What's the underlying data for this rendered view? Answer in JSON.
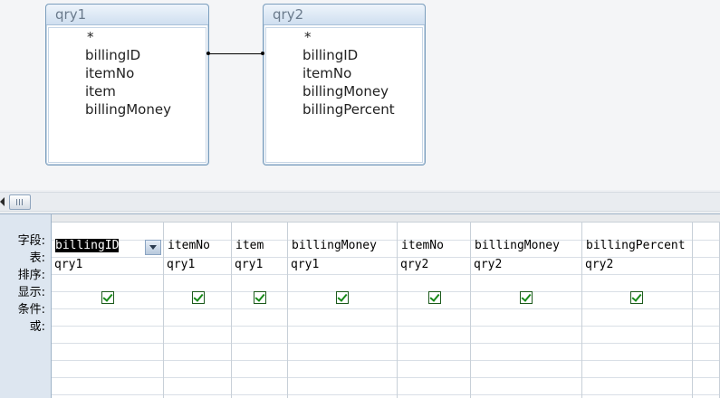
{
  "diagram": {
    "tables": [
      {
        "title": "qry1",
        "fields": [
          "*",
          "billingID",
          "itemNo",
          "item",
          "billingMoney"
        ]
      },
      {
        "title": "qry2",
        "fields": [
          "*",
          "billingID",
          "itemNo",
          "billingMoney",
          "billingPercent"
        ]
      }
    ]
  },
  "grid": {
    "row_labels": [
      "字段:",
      "表:",
      "排序:",
      "显示:",
      "条件:",
      "或:"
    ],
    "columns": [
      {
        "field": "billingID",
        "table": "qry1",
        "show": true
      },
      {
        "field": "itemNo",
        "table": "qry1",
        "show": true
      },
      {
        "field": "item",
        "table": "qry1",
        "show": true
      },
      {
        "field": "billingMoney",
        "table": "qry1",
        "show": true
      },
      {
        "field": "itemNo",
        "table": "qry2",
        "show": true
      },
      {
        "field": "billingMoney",
        "table": "qry2",
        "show": true
      },
      {
        "field": "billingPercent",
        "table": "qry2",
        "show": true
      }
    ]
  },
  "icons": {
    "scroll_left": "triangle-left-icon",
    "dropdown": "chevron-down-icon",
    "checkbox": "check-icon"
  }
}
